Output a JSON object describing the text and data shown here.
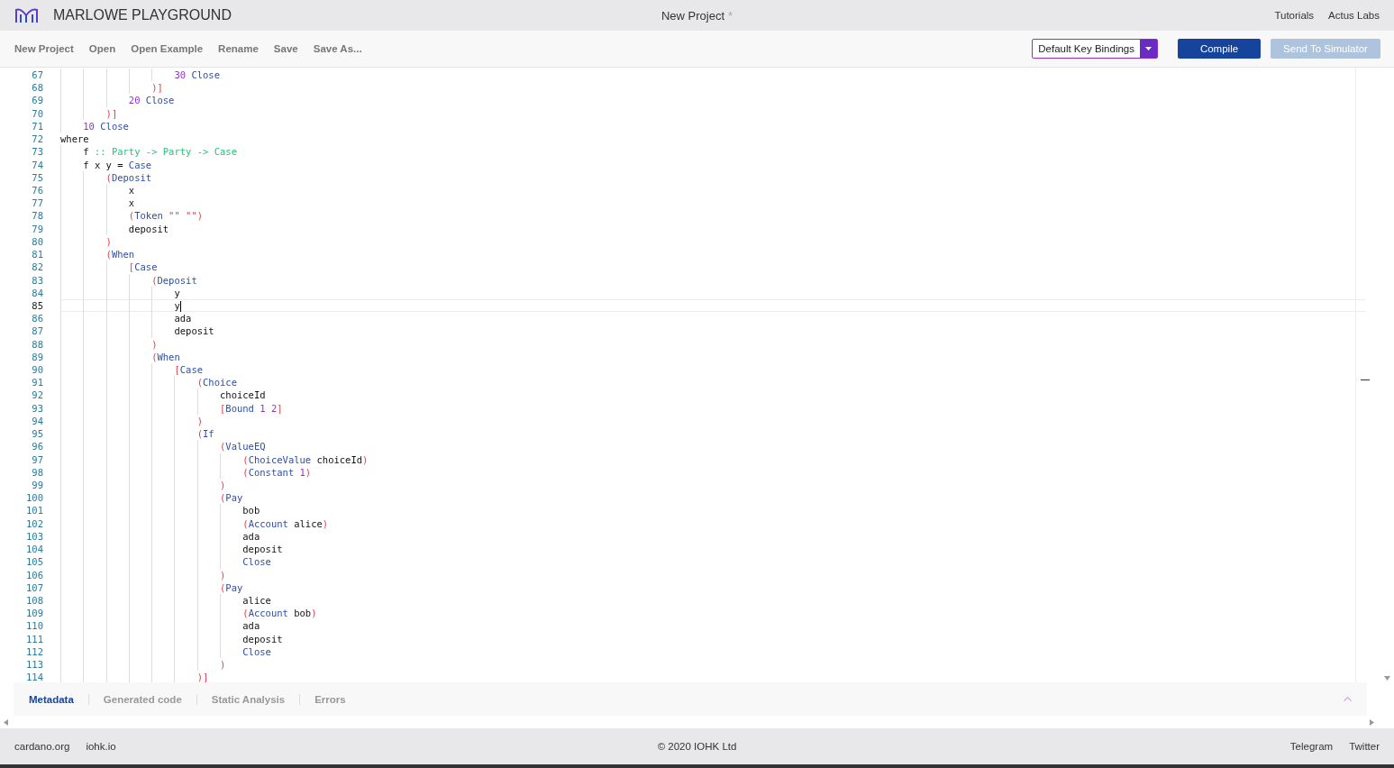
{
  "header": {
    "app_name": "MARLOWE PLAYGROUND",
    "project_title": "New Project",
    "unsaved_mark": "*",
    "links": [
      "Tutorials",
      "Actus Labs"
    ]
  },
  "toolbar": {
    "actions": [
      "New Project",
      "Open",
      "Open Example",
      "Rename",
      "Save",
      "Save As..."
    ],
    "key_bindings": "Default Key Bindings",
    "buttons": [
      {
        "label": "Compile",
        "disabled": false
      },
      {
        "label": "Send To Simulator",
        "disabled": true
      }
    ]
  },
  "editor": {
    "lines": [
      {
        "n": "67",
        "current": false,
        "tokens": [
          {
            "text": "                    30",
            "kind": "number"
          },
          {
            "text": " Close",
            "kind": "keyword"
          }
        ]
      },
      {
        "n": "68",
        "current": false,
        "tokens": [
          {
            "text": "                )]",
            "kind": "bracket"
          }
        ]
      },
      {
        "n": "69",
        "current": false,
        "tokens": [
          {
            "text": "            20",
            "kind": "number"
          },
          {
            "text": " Close",
            "kind": "keyword"
          }
        ]
      },
      {
        "n": "70",
        "current": false,
        "tokens": [
          {
            "text": "        )]",
            "kind": "bracket"
          }
        ]
      },
      {
        "n": "71",
        "current": false,
        "tokens": [
          {
            "text": "    10",
            "kind": "number"
          },
          {
            "text": " Close",
            "kind": "keyword"
          }
        ]
      },
      {
        "n": "72",
        "current": false,
        "tokens": [
          {
            "text": "where",
            "kind": "plain"
          }
        ]
      },
      {
        "n": "73",
        "current": false,
        "tokens": [
          {
            "text": "    f",
            "kind": "plain"
          },
          {
            "text": " :: Party -> Party -> Case",
            "kind": "type"
          }
        ]
      },
      {
        "n": "74",
        "current": false,
        "tokens": [
          {
            "text": "    f x y =",
            "kind": "plain"
          },
          {
            "text": " Case",
            "kind": "keyword"
          }
        ]
      },
      {
        "n": "75",
        "current": false,
        "tokens": [
          {
            "text": "        (",
            "kind": "bracket"
          },
          {
            "text": "Deposit",
            "kind": "keyword"
          }
        ]
      },
      {
        "n": "76",
        "current": false,
        "tokens": [
          {
            "text": "            x",
            "kind": "plain"
          }
        ]
      },
      {
        "n": "77",
        "current": false,
        "tokens": [
          {
            "text": "            x",
            "kind": "plain"
          }
        ]
      },
      {
        "n": "78",
        "current": false,
        "tokens": [
          {
            "text": "            (",
            "kind": "bracket"
          },
          {
            "text": "Token",
            "kind": "keyword"
          },
          {
            "text": " \"\" \"\")",
            "kind": "bracket"
          }
        ]
      },
      {
        "n": "79",
        "current": false,
        "tokens": [
          {
            "text": "            deposit",
            "kind": "plain"
          }
        ]
      },
      {
        "n": "80",
        "current": false,
        "tokens": [
          {
            "text": "        )",
            "kind": "bracket"
          }
        ]
      },
      {
        "n": "81",
        "current": false,
        "tokens": [
          {
            "text": "        (",
            "kind": "bracket"
          },
          {
            "text": "When",
            "kind": "keyword"
          }
        ]
      },
      {
        "n": "82",
        "current": false,
        "tokens": [
          {
            "text": "            [",
            "kind": "bracket"
          },
          {
            "text": "Case",
            "kind": "keyword"
          }
        ]
      },
      {
        "n": "83",
        "current": false,
        "tokens": [
          {
            "text": "                (",
            "kind": "bracket"
          },
          {
            "text": "Deposit",
            "kind": "keyword"
          }
        ]
      },
      {
        "n": "84",
        "current": false,
        "tokens": [
          {
            "text": "                    y",
            "kind": "plain"
          }
        ]
      },
      {
        "n": "85",
        "current": true,
        "tokens": [
          {
            "text": "                    y",
            "kind": "plain"
          }
        ]
      },
      {
        "n": "86",
        "current": false,
        "tokens": [
          {
            "text": "                    ada",
            "kind": "plain"
          }
        ]
      },
      {
        "n": "87",
        "current": false,
        "tokens": [
          {
            "text": "                    deposit",
            "kind": "plain"
          }
        ]
      },
      {
        "n": "88",
        "current": false,
        "tokens": [
          {
            "text": "                )",
            "kind": "bracket"
          }
        ]
      },
      {
        "n": "89",
        "current": false,
        "tokens": [
          {
            "text": "                (",
            "kind": "bracket"
          },
          {
            "text": "When",
            "kind": "keyword"
          }
        ]
      },
      {
        "n": "90",
        "current": false,
        "tokens": [
          {
            "text": "                    [",
            "kind": "bracket"
          },
          {
            "text": "Case",
            "kind": "keyword"
          }
        ]
      },
      {
        "n": "91",
        "current": false,
        "tokens": [
          {
            "text": "                        (",
            "kind": "bracket"
          },
          {
            "text": "Choice",
            "kind": "keyword"
          }
        ]
      },
      {
        "n": "92",
        "current": false,
        "tokens": [
          {
            "text": "                            choiceId",
            "kind": "plain"
          }
        ]
      },
      {
        "n": "93",
        "current": false,
        "tokens": [
          {
            "text": "                            [",
            "kind": "bracket"
          },
          {
            "text": "Bound",
            "kind": "keyword"
          },
          {
            "text": " 1 2",
            "kind": "number"
          },
          {
            "text": "]",
            "kind": "bracket"
          }
        ]
      },
      {
        "n": "94",
        "current": false,
        "tokens": [
          {
            "text": "                        )",
            "kind": "bracket"
          }
        ]
      },
      {
        "n": "95",
        "current": false,
        "tokens": [
          {
            "text": "                        (",
            "kind": "bracket"
          },
          {
            "text": "If",
            "kind": "keyword"
          }
        ]
      },
      {
        "n": "96",
        "current": false,
        "tokens": [
          {
            "text": "                            (",
            "kind": "bracket"
          },
          {
            "text": "ValueEQ",
            "kind": "keyword"
          }
        ]
      },
      {
        "n": "97",
        "current": false,
        "tokens": [
          {
            "text": "                                (",
            "kind": "bracket"
          },
          {
            "text": "ChoiceValue",
            "kind": "keyword"
          },
          {
            "text": " choiceId",
            "kind": "plain"
          },
          {
            "text": ")",
            "kind": "bracket"
          }
        ]
      },
      {
        "n": "98",
        "current": false,
        "tokens": [
          {
            "text": "                                (",
            "kind": "bracket"
          },
          {
            "text": "Constant",
            "kind": "keyword"
          },
          {
            "text": " 1",
            "kind": "number"
          },
          {
            "text": ")",
            "kind": "bracket"
          }
        ]
      },
      {
        "n": "99",
        "current": false,
        "tokens": [
          {
            "text": "                            )",
            "kind": "bracket"
          }
        ]
      },
      {
        "n": "100",
        "current": false,
        "tokens": [
          {
            "text": "                            (",
            "kind": "bracket"
          },
          {
            "text": "Pay",
            "kind": "keyword"
          }
        ]
      },
      {
        "n": "101",
        "current": false,
        "tokens": [
          {
            "text": "                                bob",
            "kind": "plain"
          }
        ]
      },
      {
        "n": "102",
        "current": false,
        "tokens": [
          {
            "text": "                                (",
            "kind": "bracket"
          },
          {
            "text": "Account",
            "kind": "keyword"
          },
          {
            "text": " alice",
            "kind": "plain"
          },
          {
            "text": ")",
            "kind": "bracket"
          }
        ]
      },
      {
        "n": "103",
        "current": false,
        "tokens": [
          {
            "text": "                                ada",
            "kind": "plain"
          }
        ]
      },
      {
        "n": "104",
        "current": false,
        "tokens": [
          {
            "text": "                                deposit",
            "kind": "plain"
          }
        ]
      },
      {
        "n": "105",
        "current": false,
        "tokens": [
          {
            "text": "                                Close",
            "kind": "keyword"
          }
        ]
      },
      {
        "n": "106",
        "current": false,
        "tokens": [
          {
            "text": "                            )",
            "kind": "bracket"
          }
        ]
      },
      {
        "n": "107",
        "current": false,
        "tokens": [
          {
            "text": "                            (",
            "kind": "bracket"
          },
          {
            "text": "Pay",
            "kind": "keyword"
          }
        ]
      },
      {
        "n": "108",
        "current": false,
        "tokens": [
          {
            "text": "                                alice",
            "kind": "plain"
          }
        ]
      },
      {
        "n": "109",
        "current": false,
        "tokens": [
          {
            "text": "                                (",
            "kind": "bracket"
          },
          {
            "text": "Account",
            "kind": "keyword"
          },
          {
            "text": " bob",
            "kind": "plain"
          },
          {
            "text": ")",
            "kind": "bracket"
          }
        ]
      },
      {
        "n": "110",
        "current": false,
        "tokens": [
          {
            "text": "                                ada",
            "kind": "plain"
          }
        ]
      },
      {
        "n": "111",
        "current": false,
        "tokens": [
          {
            "text": "                                deposit",
            "kind": "plain"
          }
        ]
      },
      {
        "n": "112",
        "current": false,
        "tokens": [
          {
            "text": "                                Close",
            "kind": "keyword"
          }
        ]
      },
      {
        "n": "113",
        "current": false,
        "tokens": [
          {
            "text": "                            )",
            "kind": "bracket"
          }
        ]
      },
      {
        "n": "114",
        "current": false,
        "tokens": [
          {
            "text": "                        )]",
            "kind": "bracket"
          }
        ]
      }
    ]
  },
  "bottom_tabs": [
    {
      "label": "Metadata",
      "selected": true
    },
    {
      "label": "Generated code",
      "selected": false
    },
    {
      "label": "Static Analysis",
      "selected": false
    },
    {
      "label": "Errors",
      "selected": false
    }
  ],
  "footer": {
    "left_links": [
      "cardano.org",
      "iohk.io"
    ],
    "copyright": "© 2020 IOHK Ltd",
    "right_links": [
      "Telegram",
      "Twitter"
    ]
  }
}
